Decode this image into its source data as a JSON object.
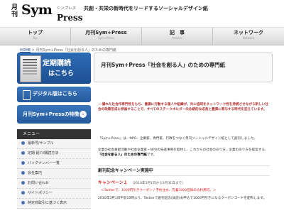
{
  "header": {
    "logo_kanji": "月刊",
    "logo_sym": "Sym",
    "logo_kana": "シンプレス",
    "logo_press": "Press",
    "tagline": "共創・共栄の新時代をリードするソーシャルデザイン紙"
  },
  "nav": [
    {
      "label": "トップ",
      "sub": "Top"
    },
    {
      "label": "月刊Sym+Press",
      "sub": "Sym+Press"
    },
    {
      "label": "記　事",
      "sub": "Articles"
    },
    {
      "label": "ネットワーク",
      "sub": "Network"
    }
  ],
  "breadcrumb": {
    "home": "HOME",
    "sep": " > ",
    "current": "月刊Sym+Press「社会を創る人」のための専門紙"
  },
  "sidebar": {
    "subscribe_line1": "定期購読",
    "subscribe_line2": "はこちら",
    "digital": "デジタル版はこちら",
    "features": "月刊Sym+Pressの特徴",
    "feature_arrow": "›",
    "menu_title": "メニュー",
    "menu_items": [
      "最新号/サンプル",
      "定期 紹介/購読方法",
      "バックナンバー一覧",
      "会社案内",
      "お問い合わせ",
      "サイトポリシー",
      "特定商取引に基づく表示"
    ]
  },
  "main": {
    "title": "月刊Sym+Press「社会を創る人」のための専門紙",
    "intro": "---優れた社会作専門性をもち、意識に行動する個人や組織が、共に協同をネットワーク性を持続させながら新しい社会の政策形成に参画することで、すべてのステークホルダーの永続的な成長と豊潤に寄与する時代を迎えています。",
    "body": "「Sym+Press」は、NPO、企業家、専門家、行政をつなぐ月刊ソーシャルデザイン紙として創刊しました。",
    "para2_pre": "企業の社会貢献活動や社会企業家・NPOの先進事例を取材し、これからの社会のあり方、企業のあり方を提案する、",
    "para2_bold": "「社会を創る人」のための専門紙",
    "para2_post": "です。",
    "section_prefix": "創刊記念キャンペーン実施中",
    "campaign_title": "キャンペーン１",
    "campaign_period": "（2010年3月1日から3月31日まで）",
    "twitter_note": "＜Twitterで、1000円引きクーポン / 予約注文、先着1000名様のみ利用可。＞",
    "campaign_text": "2010年3月1日午前10時より、Twitterで創刊記念(試読)お申込で1000円引きになるクーポンコードを配布します。"
  }
}
